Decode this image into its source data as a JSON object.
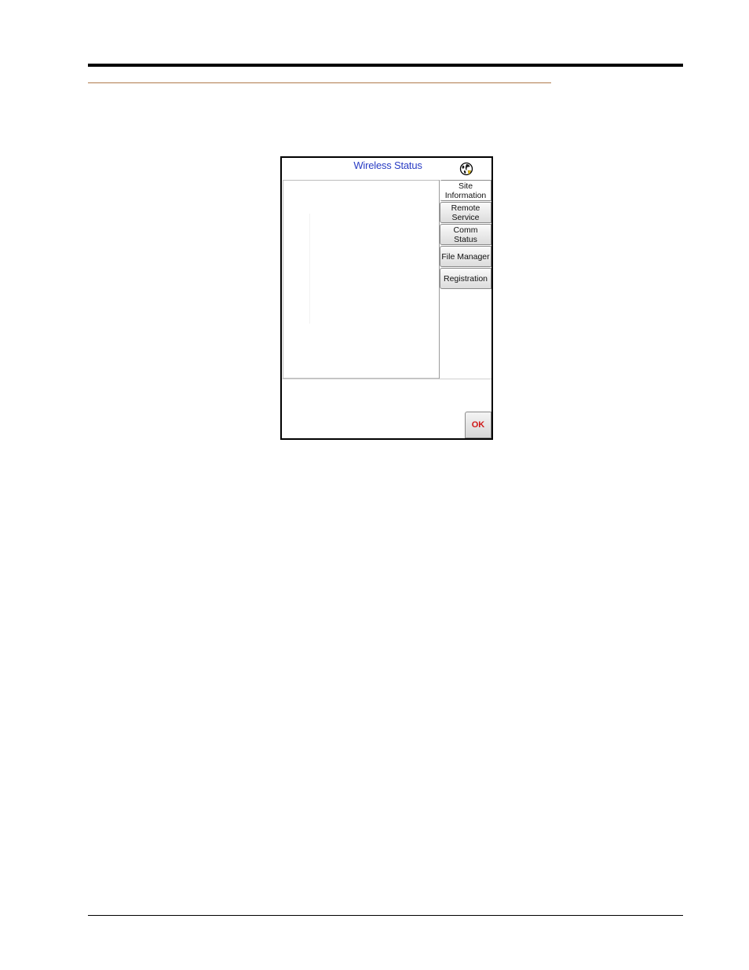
{
  "screen": {
    "title": "Wireless Status",
    "icon": "globe-icon"
  },
  "tabs": [
    {
      "label": "Site\nInformation",
      "selected": true
    },
    {
      "label": "Remote\nService",
      "selected": false
    },
    {
      "label": "Comm\nStatus",
      "selected": false
    },
    {
      "label": "File Manager",
      "selected": false
    },
    {
      "label": "Registration",
      "selected": false
    }
  ],
  "footer": {
    "ok_label": "OK"
  },
  "colors": {
    "title_text": "#2a3dc4",
    "ok_text": "#d01818",
    "accent_rule": "#b07a4a"
  }
}
